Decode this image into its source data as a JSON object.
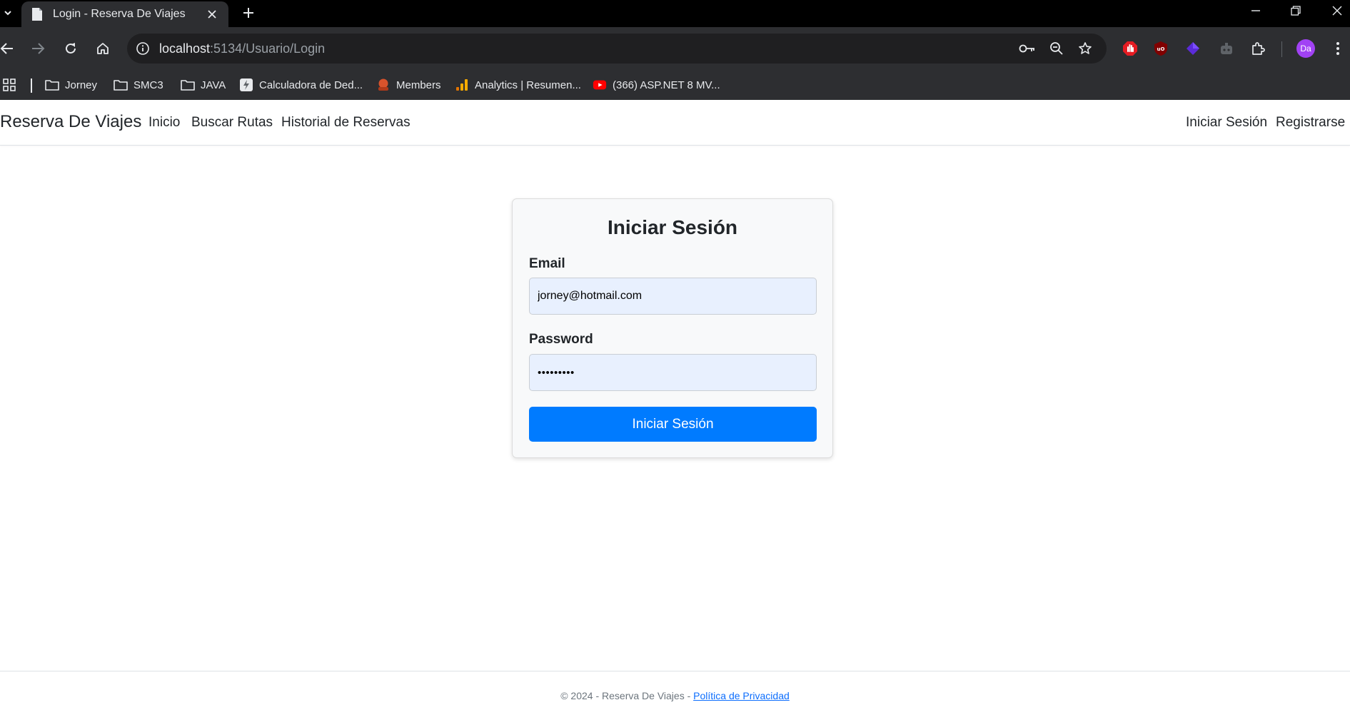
{
  "browser": {
    "tab": {
      "title": "Login - Reserva De Viajes"
    },
    "address": {
      "host": "localhost",
      "path": ":5134/Usuario/Login"
    },
    "profile": {
      "initials": "Da",
      "color": "#a142f4"
    },
    "bookmarks": [
      {
        "label": "Jorney",
        "icon": "folder-icon"
      },
      {
        "label": "SMC3",
        "icon": "folder-icon"
      },
      {
        "label": "JAVA",
        "icon": "folder-icon"
      },
      {
        "label": "Calculadora de Ded...",
        "icon": "calculator-favicon"
      },
      {
        "label": "Members",
        "icon": "members-favicon"
      },
      {
        "label": "Analytics | Resumen...",
        "icon": "analytics-favicon"
      },
      {
        "label": "(366) ASP.NET 8 MV...",
        "icon": "youtube-favicon"
      }
    ]
  },
  "navbar": {
    "brand": "Reserva De Viajes",
    "links": [
      "Inicio",
      "Buscar Rutas",
      "Historial de Reservas"
    ],
    "right_links": [
      "Iniciar Sesión",
      "Registrarse"
    ]
  },
  "login": {
    "title": "Iniciar Sesión",
    "email_label": "Email",
    "email_value": "jorney@hotmail.com",
    "password_label": "Password",
    "password_value": "•••••••••",
    "submit_label": "Iniciar Sesión"
  },
  "footer": {
    "text": "© 2024 - Reserva De Viajes - ",
    "link": "Política de Privacidad"
  },
  "colors": {
    "primary": "#007bff",
    "input_autofill": "#e8f0fe",
    "link": "#0d6efd"
  }
}
